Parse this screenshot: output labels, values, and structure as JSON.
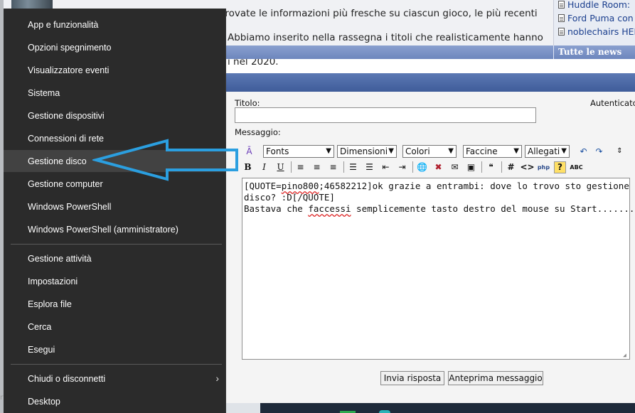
{
  "article": {
    "lines": [
      "All'interno di ogni pagina trovate le informazioni più fresche su ciascun gioco, le più recenti",
      "Abbiamo inserito nella rassegna i titoli che realisticamente hanno",
      "i nel 2020."
    ]
  },
  "news": {
    "items": [
      "Huddle Room: ",
      "Ford Puma con",
      "noblechairs HER"
    ],
    "all_news_label": "Tutte le news"
  },
  "form": {
    "title_label": "Titolo:",
    "auth_label": "Autenticato",
    "message_label": "Messaggio:",
    "selects": {
      "fonts": "Fonts",
      "sizes": "Dimensioni",
      "colors": "Colori",
      "smilies": "Faccine",
      "attachments": "Allegati"
    },
    "message_lines": [
      "[QUOTE=pino800;46582212]ok grazie a entrambi: dove lo trovo sto gestione",
      "disco? :D[/QUOTE]",
      "Bastava che faccessi semplicemente tasto destro del mouse su Start..........."
    ],
    "submit_label": "Invia risposta",
    "preview_label": "Anteprima messaggio"
  },
  "winx_menu": {
    "items": [
      "App e funzionalità",
      "Opzioni spegnimento",
      "Visualizzatore eventi",
      "Sistema",
      "Gestione dispositivi",
      "Connessioni di rete",
      "Gestione disco",
      "Gestione computer",
      "Windows PowerShell",
      "Windows PowerShell (amministratore)",
      "Gestione attività",
      "Impostazioni",
      "Esplora file",
      "Cerca",
      "Esegui",
      "Chiudi o disconnetti",
      "Desktop"
    ],
    "highlighted": "Gestione disco"
  },
  "colors": {
    "menu_bg": "#2b2b2b",
    "menu_highlight": "#424242",
    "annotation_arrow": "#2b9fe0",
    "forum_blue": "#4a66a4"
  }
}
